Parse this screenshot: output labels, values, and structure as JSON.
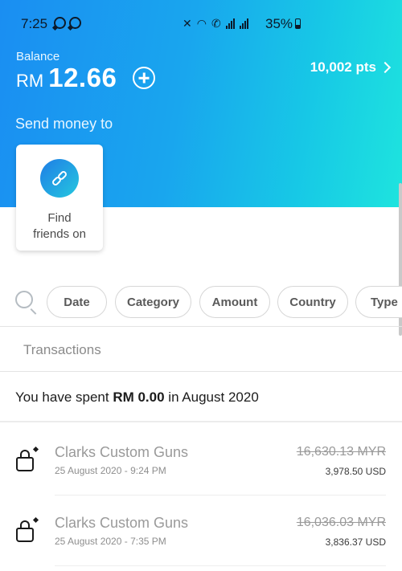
{
  "status_bar": {
    "time": "7:25",
    "battery": "35%",
    "icons": [
      "whatsapp-icon",
      "whatsapp-icon",
      "mute-icon",
      "wifi-icon",
      "wifi-call-icon",
      "signal-icon",
      "signal-icon",
      "battery-icon"
    ]
  },
  "balance": {
    "label": "Balance",
    "currency": "RM",
    "amount": "12.66",
    "add_icon": "plus-circle-icon",
    "points": "10,002 pts"
  },
  "send_money": {
    "label": "Send money to",
    "find_friends": "Find\nfriends on",
    "find_icon": "link-icon"
  },
  "filters": {
    "search_icon": "search-icon",
    "chips": [
      "Date",
      "Category",
      "Amount",
      "Country",
      "Type"
    ]
  },
  "transactions": {
    "header": "Transactions",
    "spent_prefix": "You have spent ",
    "spent_amount": "RM 0.00",
    "spent_suffix": " in August 2020",
    "items": [
      {
        "merchant": "Clarks Custom Guns",
        "date": "25 August 2020 - 9:24 PM",
        "original_amount": "16,630.13 MYR",
        "usd_amount": "3,978.50 USD",
        "icon": "shopping-bag-icon"
      },
      {
        "merchant": "Clarks Custom Guns",
        "date": "25 August 2020 - 7:35 PM",
        "original_amount": "16,036.03 MYR",
        "usd_amount": "3,836.37 USD",
        "icon": "shopping-bag-icon"
      }
    ]
  },
  "colors": {
    "gradient_start": "#1a8ef2",
    "gradient_end": "#1ee4de",
    "text_muted": "#9a9a9a"
  }
}
